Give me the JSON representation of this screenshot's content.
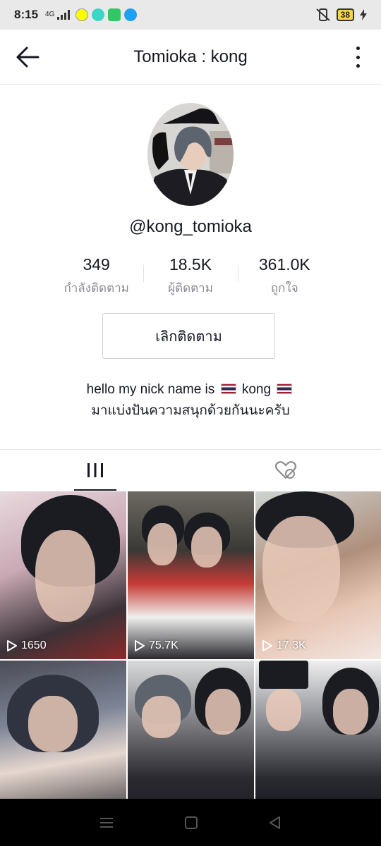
{
  "status_bar": {
    "time": "8:15",
    "network": "4G",
    "battery": "38",
    "apps": [
      {
        "name": "snapchat-icon",
        "color": "#fffc00"
      },
      {
        "name": "emoji-app-icon",
        "color": "#3bd6c6"
      },
      {
        "name": "download-icon",
        "color": "#31c765"
      },
      {
        "name": "twitter-icon",
        "color": "#1da1f2"
      }
    ]
  },
  "header": {
    "title": "Tomioka : kong"
  },
  "profile": {
    "username": "@kong_tomioka",
    "stats": [
      {
        "value": "349",
        "label": "กำลังติดตาม"
      },
      {
        "value": "18.5K",
        "label": "ผู้ติดตาม"
      },
      {
        "value": "361.0K",
        "label": "ถูกใจ"
      }
    ],
    "unfollow_label": "เลิกติดตาม",
    "bio_line1_prefix": "hello my nick name is",
    "bio_line1_name": "kong",
    "bio_line2": "มาแบ่งปันความสนุกด้วยกันนะครับ"
  },
  "tabs": [
    {
      "name": "videos",
      "icon": "grid-icon",
      "active": true
    },
    {
      "name": "liked",
      "icon": "liked-hidden-icon",
      "active": false
    }
  ],
  "videos": [
    {
      "views": "1650"
    },
    {
      "views": "75.7K"
    },
    {
      "views": "17.3K"
    },
    {
      "views": ""
    },
    {
      "views": ""
    },
    {
      "views": ""
    }
  ]
}
